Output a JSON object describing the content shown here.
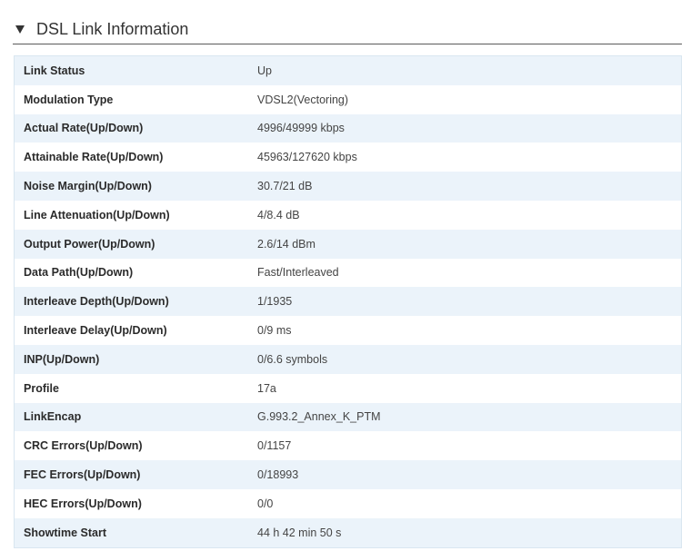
{
  "section": {
    "title": "DSL Link Information",
    "collapse_icon": "triangle-down-icon"
  },
  "rows": [
    {
      "label": "Link Status",
      "value": "Up"
    },
    {
      "label": "Modulation Type",
      "value": "VDSL2(Vectoring)"
    },
    {
      "label": "Actual Rate(Up/Down)",
      "value": "4996/49999 kbps"
    },
    {
      "label": "Attainable Rate(Up/Down)",
      "value": "45963/127620 kbps"
    },
    {
      "label": "Noise Margin(Up/Down)",
      "value": "30.7/21 dB"
    },
    {
      "label": "Line Attenuation(Up/Down)",
      "value": "4/8.4 dB"
    },
    {
      "label": "Output Power(Up/Down)",
      "value": "2.6/14 dBm"
    },
    {
      "label": "Data Path(Up/Down)",
      "value": "Fast/Interleaved"
    },
    {
      "label": "Interleave Depth(Up/Down)",
      "value": "1/1935"
    },
    {
      "label": "Interleave Delay(Up/Down)",
      "value": "0/9 ms"
    },
    {
      "label": "INP(Up/Down)",
      "value": "0/6.6 symbols"
    },
    {
      "label": "Profile",
      "value": "17a"
    },
    {
      "label": "LinkEncap",
      "value": "G.993.2_Annex_K_PTM"
    },
    {
      "label": "CRC Errors(Up/Down)",
      "value": "0/1157"
    },
    {
      "label": "FEC Errors(Up/Down)",
      "value": "0/18993"
    },
    {
      "label": "HEC Errors(Up/Down)",
      "value": "0/0"
    },
    {
      "label": "Showtime Start",
      "value": "44 h 42 min 50 s"
    }
  ],
  "colors": {
    "row_stripe": "#ebf3fa",
    "row_plain": "#ffffff",
    "table_border": "#d9e6f0",
    "header_rule": "#5a5a5a"
  }
}
